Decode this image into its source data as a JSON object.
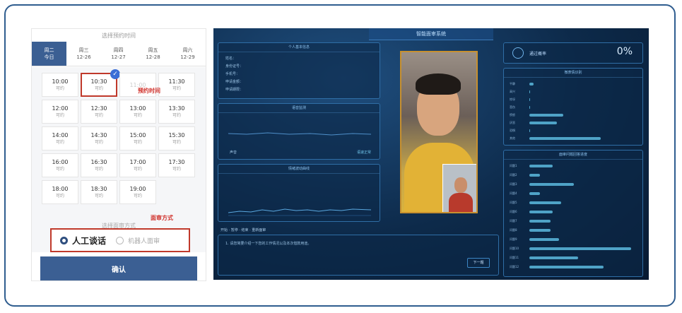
{
  "phone": {
    "section_title": "选择预约时间",
    "days": [
      {
        "week": "周二",
        "date": "今日",
        "active": true
      },
      {
        "week": "周三",
        "date": "12-26",
        "active": false
      },
      {
        "week": "周四",
        "date": "12-27",
        "active": false
      },
      {
        "week": "周五",
        "date": "12-28",
        "active": false
      },
      {
        "week": "周六",
        "date": "12-29",
        "active": false
      }
    ],
    "slots": [
      {
        "time": "10:00",
        "status": "可约",
        "col": 0,
        "row": 0
      },
      {
        "time": "10:30",
        "status": "可约",
        "col": 1,
        "row": 0,
        "selected": true
      },
      {
        "time": "11:00",
        "status": "",
        "col": 2,
        "row": 0,
        "disabled": true
      },
      {
        "time": "11:30",
        "status": "可约",
        "col": 3,
        "row": 0
      },
      {
        "time": "12:00",
        "status": "可约",
        "col": 0,
        "row": 1
      },
      {
        "time": "12:30",
        "status": "可约",
        "col": 1,
        "row": 1
      },
      {
        "time": "13:00",
        "status": "可约",
        "col": 2,
        "row": 1
      },
      {
        "time": "13:30",
        "status": "可约",
        "col": 3,
        "row": 1
      },
      {
        "time": "14:00",
        "status": "可约",
        "col": 0,
        "row": 2
      },
      {
        "time": "14:30",
        "status": "可约",
        "col": 1,
        "row": 2
      },
      {
        "time": "15:00",
        "status": "可约",
        "col": 2,
        "row": 2
      },
      {
        "time": "15:30",
        "status": "可约",
        "col": 3,
        "row": 2
      },
      {
        "time": "16:00",
        "status": "可约",
        "col": 0,
        "row": 3
      },
      {
        "time": "16:30",
        "status": "可约",
        "col": 1,
        "row": 3
      },
      {
        "time": "17:00",
        "status": "可约",
        "col": 2,
        "row": 3
      },
      {
        "time": "17:30",
        "status": "可约",
        "col": 3,
        "row": 3
      },
      {
        "time": "18:00",
        "status": "可约",
        "col": 0,
        "row": 4
      },
      {
        "time": "18:30",
        "status": "可约",
        "col": 1,
        "row": 4
      },
      {
        "time": "19:00",
        "status": "可约",
        "col": 2,
        "row": 4
      }
    ],
    "annotation_time": "预约时间",
    "annotation_mode": "面审方式",
    "mode_title": "选择面审方式",
    "mode_option_1": "人工谈话",
    "mode_option_2": "机器人面审",
    "confirm_label": "确认",
    "check_icon": "✓",
    "accent_color": "#3b5f93",
    "highlight_color": "#c0392b"
  },
  "dashboard": {
    "title": "智能面审系统",
    "panel_info_title": "个人基本信息",
    "info_rows": [
      "姓名：",
      "身份证号：",
      "手机号：",
      "申请金额：",
      "申请期限："
    ],
    "panel_wave_title": "语音监测",
    "panel_wave_label": "声音",
    "panel_wave_right": "语速正常",
    "panel_curve_title": "情绪波动曲线",
    "rate_label": "通过概率",
    "rate_value": "0%",
    "panel_bars1_title": "微表情识别",
    "panel_bars2_title": "面审问题回答进度",
    "bars1": [
      {
        "label": "平静",
        "value": 0.04
      },
      {
        "label": "高兴",
        "value": 0.0
      },
      {
        "label": "惊讶",
        "value": 0.0
      },
      {
        "label": "悲伤",
        "value": 0.0
      },
      {
        "label": "愤怒",
        "value": 0.34
      },
      {
        "label": "厌恶",
        "value": 0.28
      },
      {
        "label": "恐惧",
        "value": 0.0
      },
      {
        "label": "其他",
        "value": 0.72
      }
    ],
    "bars2": [
      {
        "label": "问题1",
        "value": 0.22
      },
      {
        "label": "问题2",
        "value": 0.1
      },
      {
        "label": "问题3",
        "value": 0.42
      },
      {
        "label": "问题4",
        "value": 0.1
      },
      {
        "label": "问题5",
        "value": 0.3
      },
      {
        "label": "问题6",
        "value": 0.22
      },
      {
        "label": "问题7",
        "value": 0.2
      },
      {
        "label": "问题8",
        "value": 0.2
      },
      {
        "label": "问题9",
        "value": 0.28
      },
      {
        "label": "问题10",
        "value": 0.96
      },
      {
        "label": "问题11",
        "value": 0.46
      },
      {
        "label": "问题12",
        "value": 0.7
      }
    ],
    "controls": "开始 · 暂停 · 结束 · 重新面审",
    "question_text": "1. 请您简要介绍一下您的工作情况以及本次借款用途。",
    "next_button": "下一题",
    "accent_color": "#2f6ea6"
  }
}
